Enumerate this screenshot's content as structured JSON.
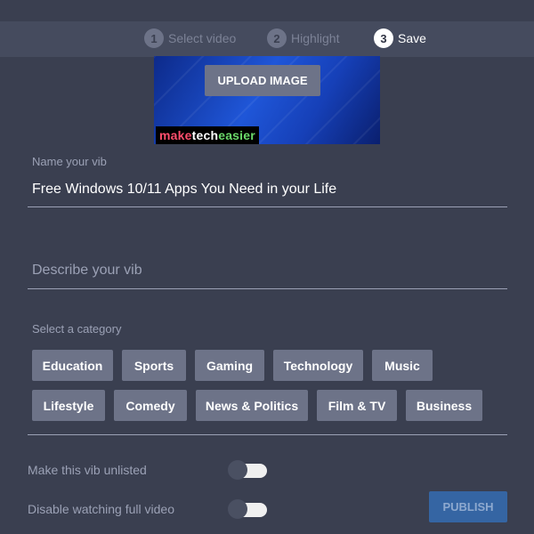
{
  "stepper": {
    "steps": [
      {
        "num": "1",
        "label": "Select video",
        "active": false
      },
      {
        "num": "2",
        "label": "Highlight",
        "active": false
      },
      {
        "num": "3",
        "label": "Save",
        "active": true
      }
    ]
  },
  "thumbnail": {
    "upload_label": "UPLOAD IMAGE",
    "logo_part1": "make",
    "logo_part2": "tech",
    "logo_part3": "easier"
  },
  "name_field": {
    "label": "Name your vib",
    "value": "Free Windows 10/11 Apps You Need in your Life"
  },
  "describe_field": {
    "placeholder": "Describe your vib",
    "value": ""
  },
  "category": {
    "label": "Select a category",
    "options": [
      "Education",
      "Sports",
      "Gaming",
      "Technology",
      "Music",
      "Lifestyle",
      "Comedy",
      "News & Politics",
      "Film & TV",
      "Business"
    ]
  },
  "toggles": {
    "unlisted_label": "Make this vib unlisted",
    "unlisted_on": false,
    "full_video_label": "Disable watching full video",
    "full_video_on": false
  },
  "publish_label": "PUBLISH",
  "colors": {
    "background": "#3a3f50",
    "chip": "#6d7388",
    "publish": "#3565a3"
  }
}
